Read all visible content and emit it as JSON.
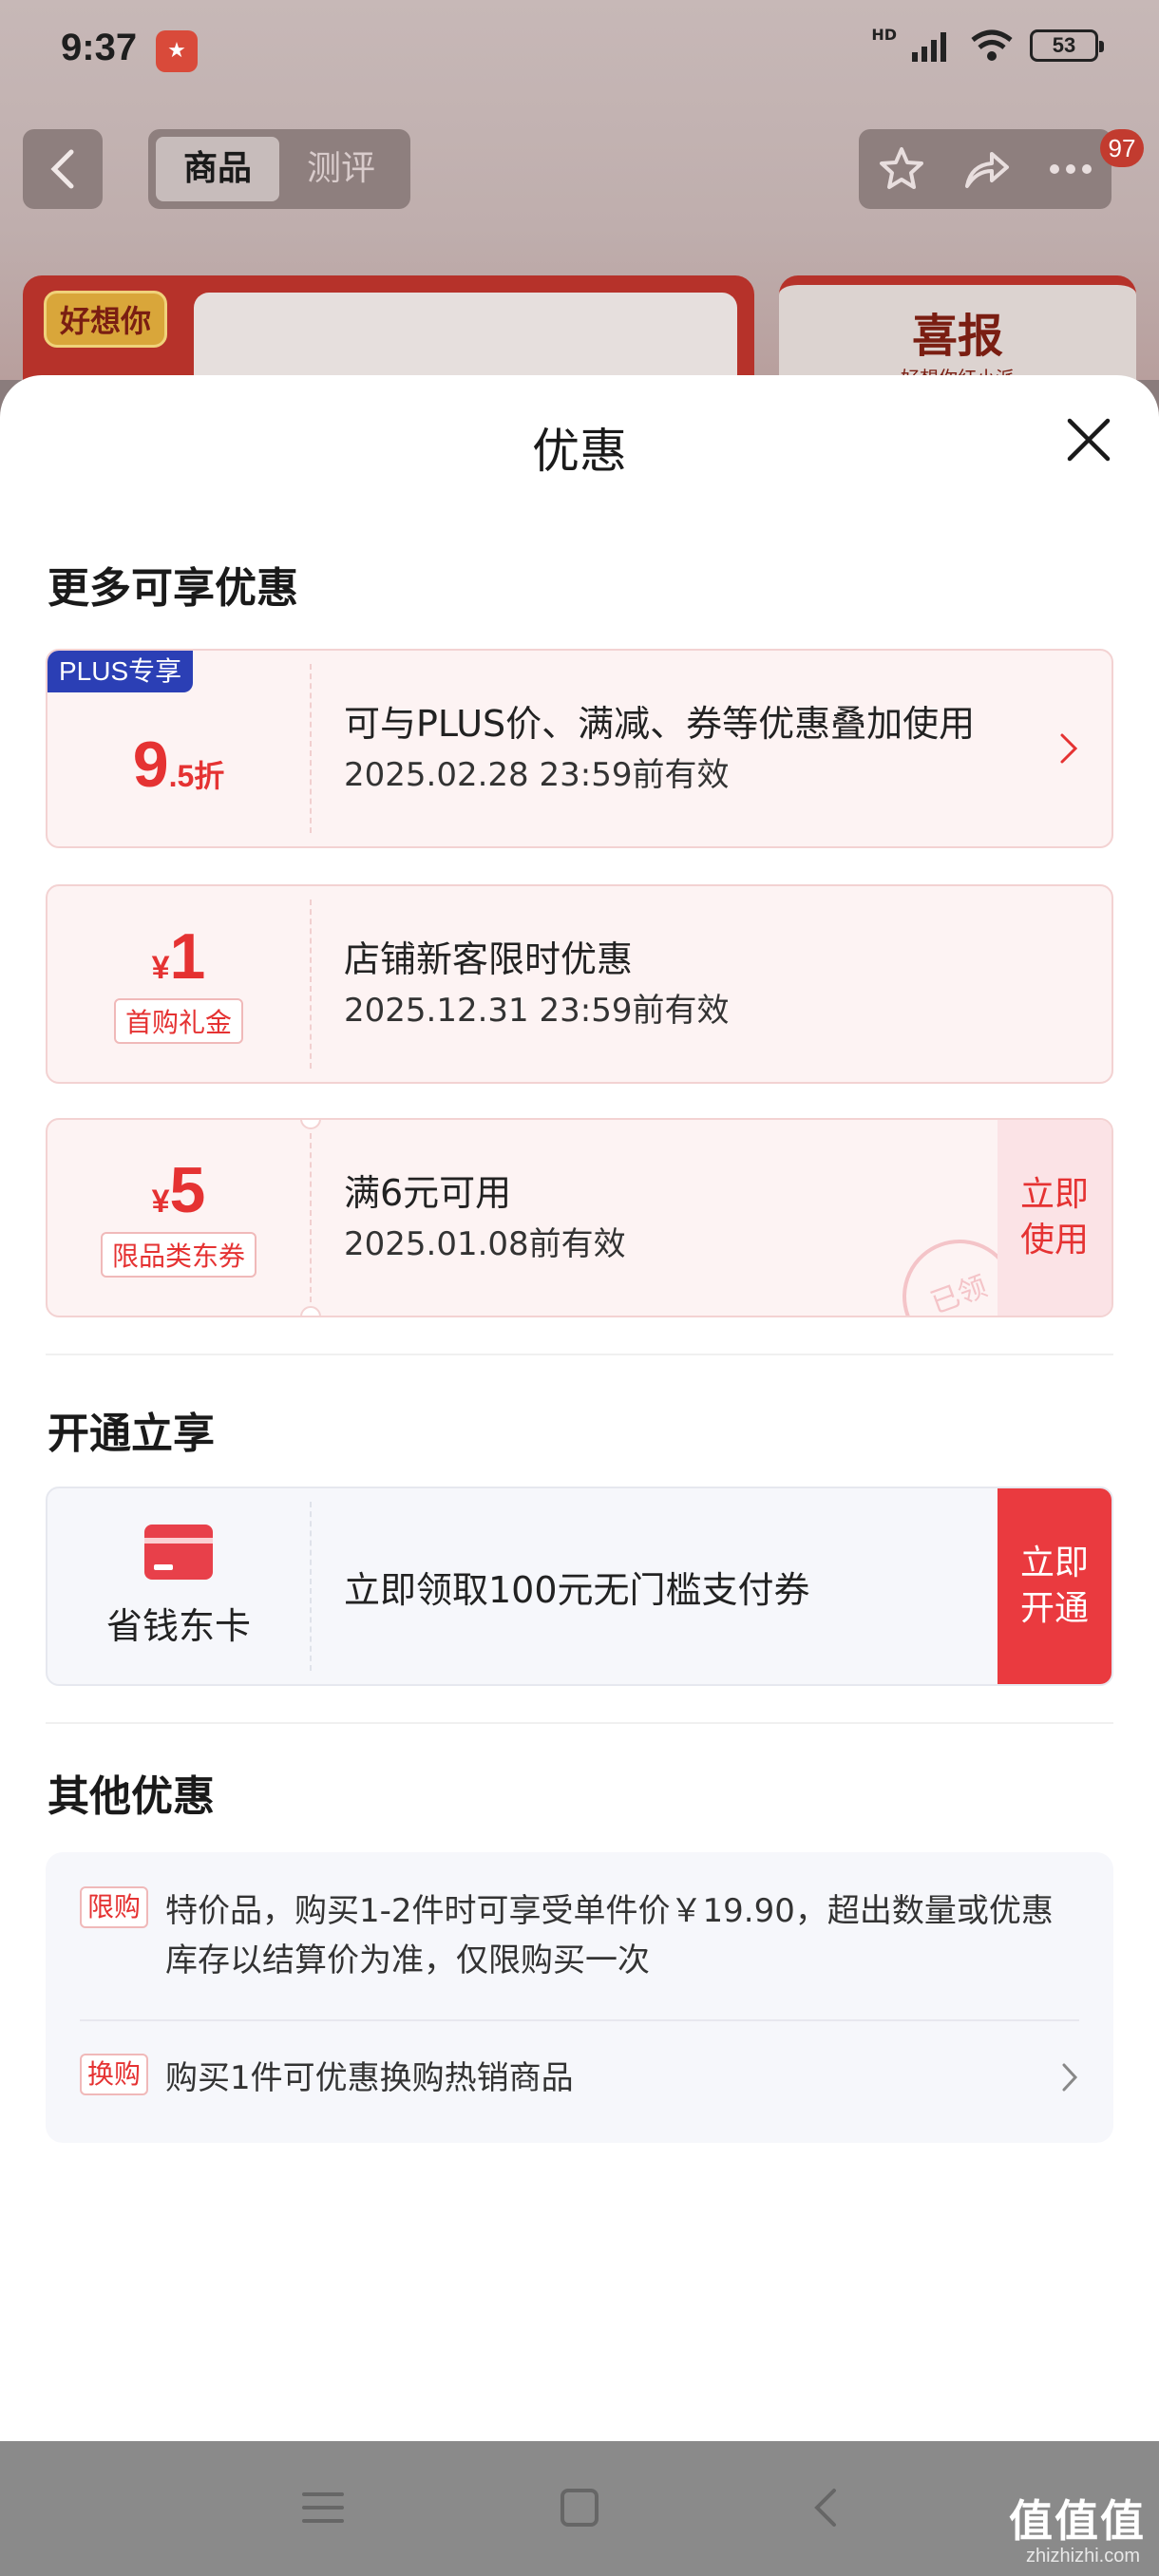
{
  "status_bar": {
    "time": "9:37",
    "network": "HD",
    "battery": "53"
  },
  "top_nav": {
    "tabs": [
      {
        "label": "商品"
      },
      {
        "label": "测评"
      }
    ],
    "badge_count": "97"
  },
  "background": {
    "product_logo": "好想你",
    "promo_title": "喜报",
    "promo_sub": "好想你红小派"
  },
  "sheet": {
    "title": "优惠",
    "sections": {
      "more": "更多可享优惠",
      "open": "开通立享",
      "other": "其他优惠"
    },
    "coupons": [
      {
        "tag": "PLUS专享",
        "discount_big": "9",
        "discount_small": ".5折",
        "desc": "可与PLUS价、满减、券等优惠叠加使用",
        "expiry": "2025.02.28 23:59前有效"
      },
      {
        "yen": "¥",
        "amount": "1",
        "label": "首购礼金",
        "desc": "店铺新客限时优惠",
        "expiry": "2025.12.31 23:59前有效"
      },
      {
        "yen": "¥",
        "amount": "5",
        "label": "限品类东券",
        "desc": "满6元可用",
        "expiry": "2025.01.08前有效",
        "action_line1": "立即",
        "action_line2": "使用",
        "stamp": "已领"
      }
    ],
    "card_offer": {
      "name": "省钱东卡",
      "desc": "立即领取100元无门槛支付券",
      "action_line1": "立即",
      "action_line2": "开通"
    },
    "other_offers": [
      {
        "tag": "限购",
        "text": "特价品，购买1-2件时可享受单件价￥19.90，超出数量或优惠库存以结算价为准，仅限购买一次"
      },
      {
        "tag": "换购",
        "text": "购买1件可优惠换购热销商品"
      }
    ]
  },
  "watermark": {
    "text": "值值值",
    "url": "zhizhizhi.com"
  },
  "colors": {
    "accent_red": "#e53232",
    "plus_blue": "#2b3fb5"
  }
}
